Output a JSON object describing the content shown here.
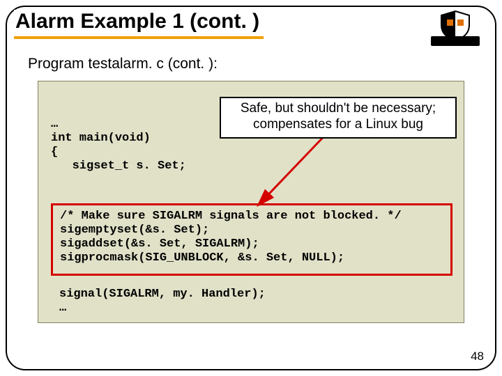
{
  "title": "Alarm Example 1 (cont. )",
  "subtitle": "Program testalarm. c (cont. ):",
  "callout": {
    "line1": "Safe, but shouldn't be necessary;",
    "line2": "compensates for a Linux bug"
  },
  "code_top": "…\nint main(void)\n{\n   sigset_t s. Set;",
  "highlight": "/* Make sure SIGALRM signals are not blocked. */\nsigemptyset(&s. Set);\nsigaddset(&s. Set, SIGALRM);\nsigprocmask(SIG_UNBLOCK, &s. Set, NULL);",
  "code_bottom": "signal(SIGALRM, my. Handler);\n…",
  "page_number": "48"
}
